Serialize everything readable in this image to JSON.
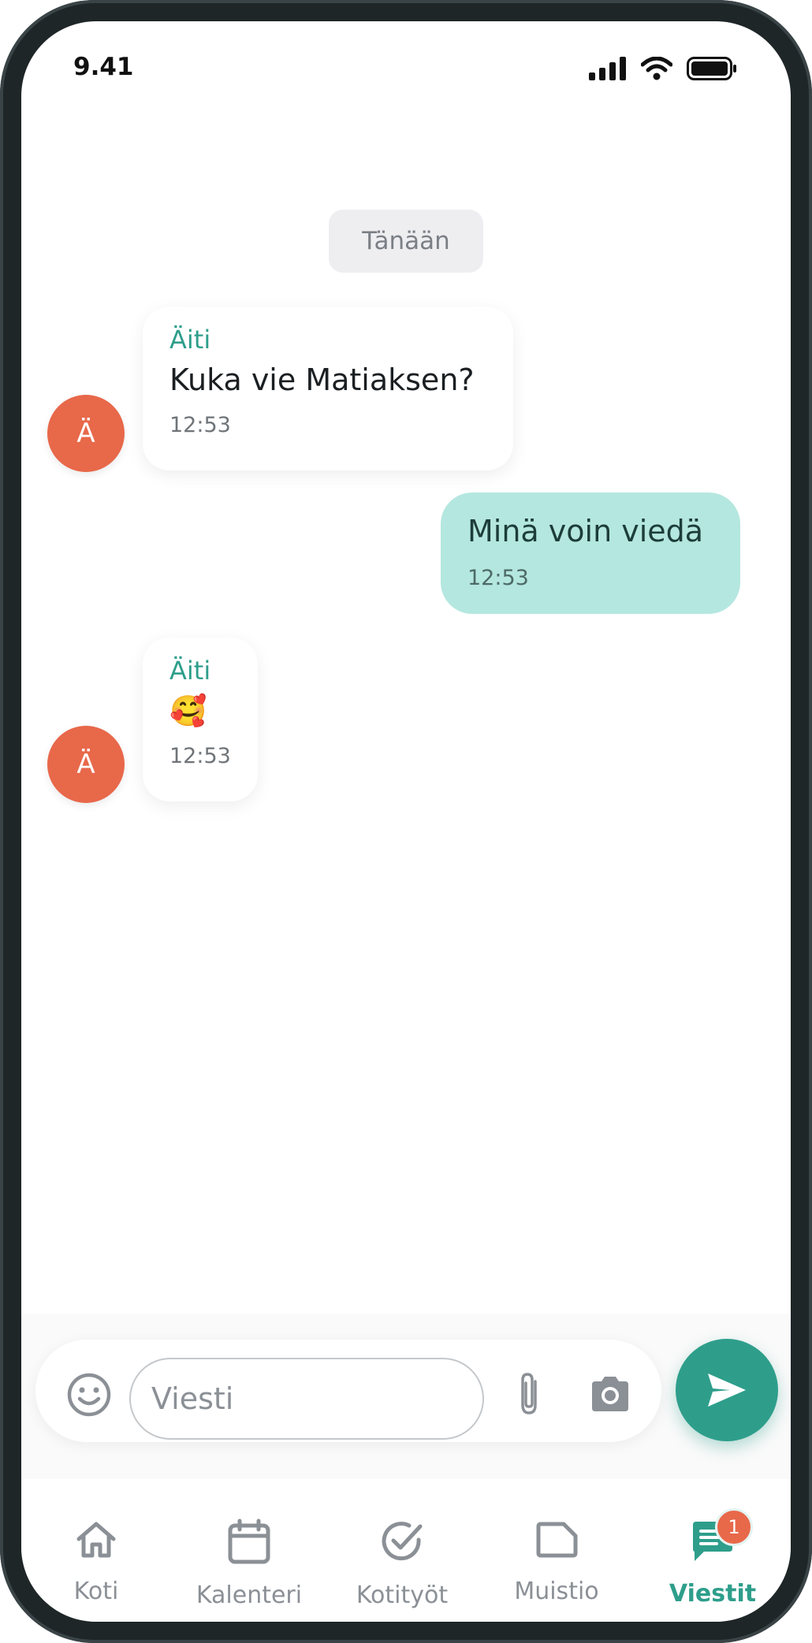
{
  "status_bar": {
    "time": "9.41"
  },
  "chat": {
    "date_divider": "Tänään",
    "messages": [
      {
        "sender": "Äiti",
        "avatar_initial": "Ä",
        "text": "Kuka vie Matiaksen?",
        "time": "12:53"
      },
      {
        "own": true,
        "text": "Minä voin viedä",
        "time": "12:53"
      },
      {
        "sender": "Äiti",
        "avatar_initial": "Ä",
        "text": "🥰",
        "time": "12:53"
      }
    ]
  },
  "composer": {
    "placeholder": "Viesti",
    "value": ""
  },
  "nav": {
    "items": [
      {
        "label": "Koti",
        "icon": "home-icon"
      },
      {
        "label": "Kalenteri",
        "icon": "calendar-icon"
      },
      {
        "label": "Kotityöt",
        "icon": "check-circle-icon"
      },
      {
        "label": "Muistio",
        "icon": "note-icon"
      },
      {
        "label": "Viestit",
        "icon": "chat-icon",
        "active": true,
        "badge": "1"
      }
    ]
  },
  "colors": {
    "accent": "#2e9e8b",
    "avatar": "#e8684a",
    "own_bubble": "#b4e7df",
    "badge": "#e8684a"
  }
}
